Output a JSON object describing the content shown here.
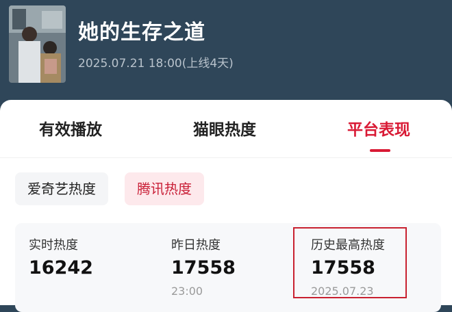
{
  "header": {
    "title": "她的生存之道",
    "release_info": "2025.07.21 18:00(上线4天)"
  },
  "tabs": [
    {
      "label": "有效播放",
      "active": false
    },
    {
      "label": "猫眼热度",
      "active": false
    },
    {
      "label": "平台表现",
      "active": true
    }
  ],
  "platform_chips": [
    {
      "label": "爱奇艺热度",
      "active": false
    },
    {
      "label": "腾讯热度",
      "active": true
    }
  ],
  "stats": [
    {
      "label": "实时热度",
      "value": "16242",
      "sub": ""
    },
    {
      "label": "昨日热度",
      "value": "17558",
      "sub": "23:00"
    },
    {
      "label": "历史最高热度",
      "value": "17558",
      "sub": "2025.07.23"
    }
  ],
  "colors": {
    "header_bg": "#2f4659",
    "accent": "#d91a35",
    "active_chip_bg": "#fde9ec",
    "highlight_border": "#c8202f"
  }
}
